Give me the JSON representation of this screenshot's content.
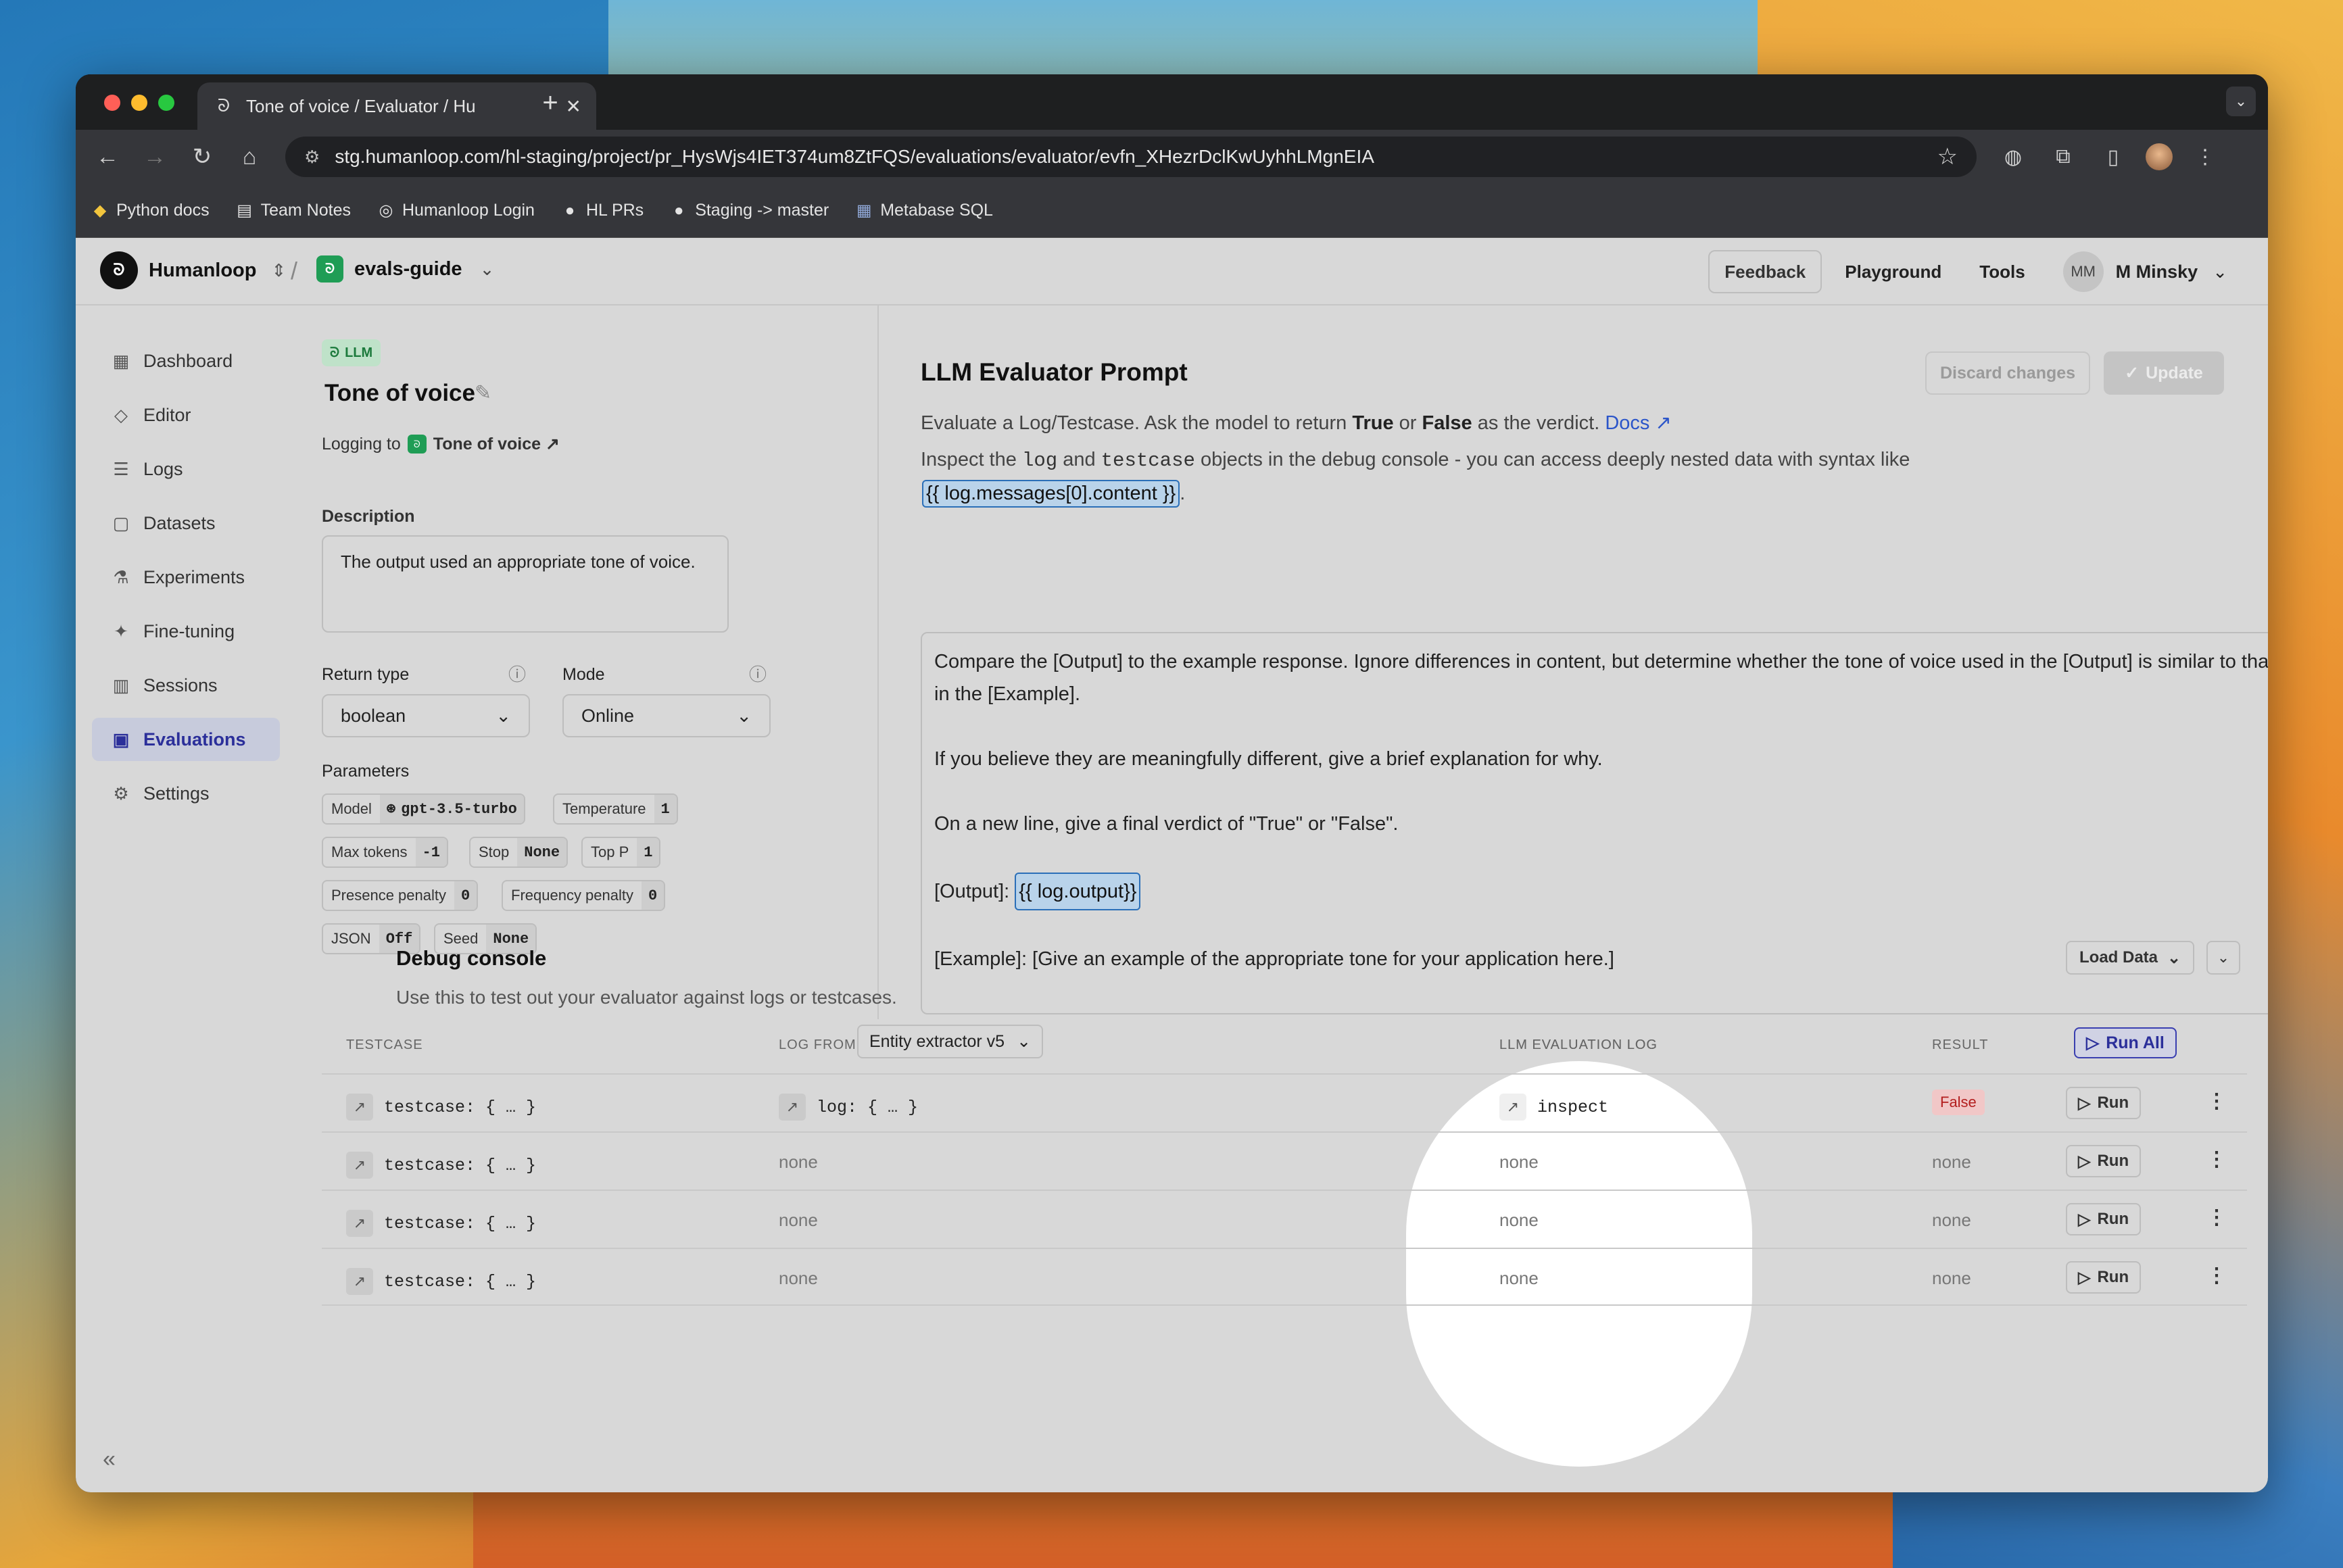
{
  "browser": {
    "tab_title": "Tone of voice / Evaluator / Hu",
    "url": "stg.humanloop.com/hl-staging/project/pr_HysWjs4IET374um8ZtFQS/evaluations/evaluator/evfn_XHezrDclKwUyhhLMgnEIA",
    "bookmarks": [
      "Python docs",
      "Team Notes",
      "Humanloop Login",
      "HL PRs",
      "Staging -> master",
      "Metabase SQL"
    ]
  },
  "header": {
    "org": "Humanloop",
    "project": "evals-guide",
    "feedback": "Feedback",
    "playground": "Playground",
    "tools": "Tools",
    "user_initials": "MM",
    "user_name": "M Minsky"
  },
  "sidebar": {
    "items": [
      {
        "label": "Dashboard",
        "icon": "grid-icon"
      },
      {
        "label": "Editor",
        "icon": "editor-icon"
      },
      {
        "label": "Logs",
        "icon": "database-icon"
      },
      {
        "label": "Datasets",
        "icon": "lock-icon"
      },
      {
        "label": "Experiments",
        "icon": "flask-icon"
      },
      {
        "label": "Fine-tuning",
        "icon": "sparkle-icon"
      },
      {
        "label": "Sessions",
        "icon": "columns-icon"
      },
      {
        "label": "Evaluations",
        "icon": "clipboard-icon"
      },
      {
        "label": "Settings",
        "icon": "gear-icon"
      }
    ],
    "active": "Evaluations"
  },
  "evaluator": {
    "badge": "LLM",
    "title": "Tone of voice",
    "logging_prefix": "Logging to",
    "logging_target": "Tone of voice ↗",
    "description_label": "Description",
    "description": "The output used an appropriate tone of voice.",
    "return_type_label": "Return type",
    "return_type": "boolean",
    "mode_label": "Mode",
    "mode": "Online",
    "parameters_label": "Parameters",
    "parameters": {
      "model_k": "Model",
      "model_v": "gpt-3.5-turbo",
      "temp_k": "Temperature",
      "temp_v": "1",
      "maxtok_k": "Max tokens",
      "maxtok_v": "-1",
      "stop_k": "Stop",
      "stop_v": "None",
      "topp_k": "Top P",
      "topp_v": "1",
      "pres_k": "Presence penalty",
      "pres_v": "0",
      "freq_k": "Frequency penalty",
      "freq_v": "0",
      "json_k": "JSON",
      "json_v": "Off",
      "seed_k": "Seed",
      "seed_v": "None"
    }
  },
  "prompt_panel": {
    "title": "LLM Evaluator Prompt",
    "discard": "Discard changes",
    "update": "Update",
    "line1_a": "Evaluate a Log/Testcase. Ask the model to return ",
    "line1_true": "True",
    "line1_or": " or ",
    "line1_false": "False",
    "line1_b": " as the verdict. ",
    "docs": "Docs ↗",
    "line2_a": "Inspect the ",
    "line2_log": "log",
    "line2_and": " and ",
    "line2_testcase": "testcase",
    "line2_b": " objects in the debug console - you can access deeply nested data with syntax like",
    "line3_tpl": "{{ log.messages[0].content }}",
    "line3_end": ".",
    "prompt_p1": "Compare the [Output] to the example response. Ignore differences in content, but determine whether the tone of voice used in the [Output] is similar to that in the [Example].",
    "prompt_p2": "If you believe they are meaningfully different, give a brief explanation for why.",
    "prompt_p3": "On a new line, give a final verdict of \"True\" or \"False\".",
    "prompt_p4_a": "[Output]: ",
    "prompt_p4_tpl": "{{ log.output}}",
    "prompt_p5": "[Example]: [Give an example of the appropriate tone for your application here.]"
  },
  "debug": {
    "title": "Debug console",
    "subtitle": "Use this to test out your evaluator against logs or testcases.",
    "load_data": "Load Data",
    "col_testcase": "TESTCASE",
    "col_logfrom": "LOG FROM",
    "logfrom_value": "Entity extractor v5",
    "col_eval": "LLM EVALUATION LOG",
    "col_result": "RESULT",
    "run_all": "Run All",
    "run": "Run",
    "rows": [
      {
        "testcase": "testcase: { … }",
        "log": "log: { … }",
        "eval": "inspect",
        "result": "False"
      },
      {
        "testcase": "testcase: { … }",
        "log": "none",
        "eval": "none",
        "result": "none"
      },
      {
        "testcase": "testcase: { … }",
        "log": "none",
        "eval": "none",
        "result": "none"
      },
      {
        "testcase": "testcase: { … }",
        "log": "none",
        "eval": "none",
        "result": "none"
      }
    ]
  }
}
